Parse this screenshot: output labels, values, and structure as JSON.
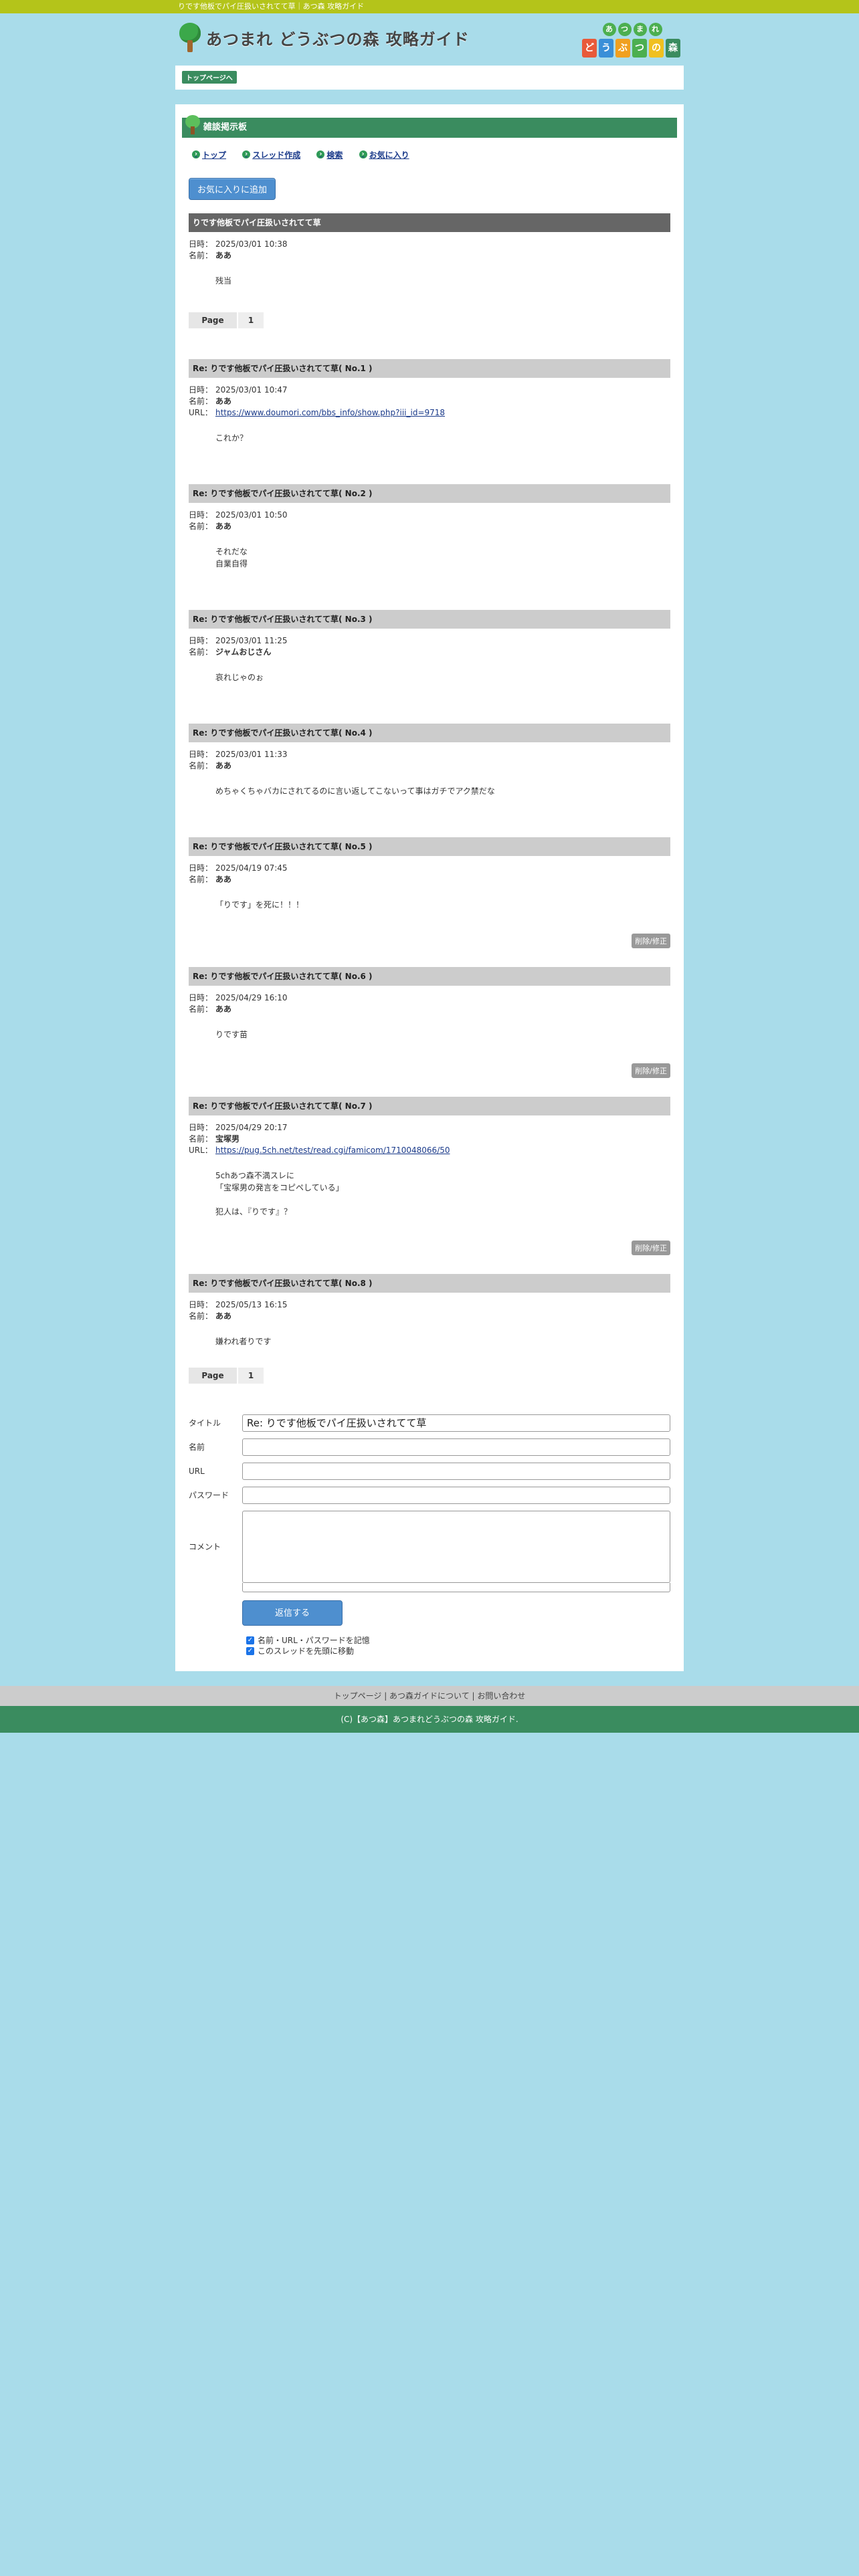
{
  "topbar": {
    "title": "りです他板でパイ圧扱いされてて草｜あつ森 攻略ガイド"
  },
  "header": {
    "logo_text": "あつまれ どうぶつの森 攻略ガイド",
    "brand_top": [
      "あ",
      "つ",
      "ま",
      "れ"
    ],
    "brand_bottom": [
      "ど",
      "う",
      "ぶ",
      "つ",
      "の",
      "森"
    ]
  },
  "breadcrumb": {
    "top": "トップページへ"
  },
  "section": {
    "title": "雑談掲示板"
  },
  "nav": {
    "top": "トップ",
    "new_thread": "スレッド作成",
    "search": "検索",
    "favorites": "お気に入り"
  },
  "fav_button": "お気に入りに追加",
  "labels": {
    "date": "日時：",
    "name": "名前：",
    "url": "URL：",
    "page": "Page",
    "page_num": "1",
    "delete": "削除/修正"
  },
  "thread": {
    "title": "りです他板でパイ圧扱いされてて草",
    "date": "2025/03/01 10:38",
    "name": "ああ",
    "body": [
      "残当"
    ]
  },
  "posts": [
    {
      "title": "Re: りです他板でパイ圧扱いされてて草( No.1 )",
      "date": "2025/03/01 10:47",
      "name": "ああ",
      "url": "https://www.doumori.com/bbs_info/show.php?iii_id=9718",
      "body": [
        "これか？"
      ],
      "delete": false
    },
    {
      "title": "Re: りです他板でパイ圧扱いされてて草( No.2 )",
      "date": "2025/03/01 10:50",
      "name": "ああ",
      "url": "",
      "body": [
        "それだな",
        "自業自得"
      ],
      "delete": false
    },
    {
      "title": "Re: りです他板でパイ圧扱いされてて草( No.3 )",
      "date": "2025/03/01 11:25",
      "name": "ジャムおじさん",
      "url": "",
      "body": [
        "哀れじゃのぉ"
      ],
      "delete": false
    },
    {
      "title": "Re: りです他板でパイ圧扱いされてて草( No.4 )",
      "date": "2025/03/01 11:33",
      "name": "ああ",
      "url": "",
      "body": [
        "めちゃくちゃバカにされてるのに言い返してこないって事はガチでアク禁だな"
      ],
      "delete": false
    },
    {
      "title": "Re: りです他板でパイ圧扱いされてて草( No.5 )",
      "date": "2025/04/19 07:45",
      "name": "ああ",
      "url": "",
      "body": [
        "「りです」を死に！！！"
      ],
      "delete": true
    },
    {
      "title": "Re: りです他板でパイ圧扱いされてて草( No.6 )",
      "date": "2025/04/29 16:10",
      "name": "ああ",
      "url": "",
      "body": [
        "りです苗"
      ],
      "delete": true
    },
    {
      "title": "Re: りです他板でパイ圧扱いされてて草( No.7 )",
      "date": "2025/04/29 20:17",
      "name": "宝塚男",
      "url": "https://pug.5ch.net/test/read.cgi/famicom/1710048066/50",
      "body": [
        "5chあつ森不満スレに",
        "「宝塚男の発言をコピペしている」",
        "",
        "犯人は、『りです』？"
      ],
      "delete": true
    },
    {
      "title": "Re: りです他板でパイ圧扱いされてて草( No.8 )",
      "date": "2025/05/13 16:15",
      "name": "ああ",
      "url": "",
      "body": [
        "嫌われ者りです"
      ],
      "delete": false
    }
  ],
  "form": {
    "title_label": "タイトル",
    "title_value": "Re: りです他板でパイ圧扱いされてて草",
    "name_label": "名前",
    "url_label": "URL",
    "password_label": "パスワード",
    "comment_label": "コメント",
    "submit": "返信する",
    "remember": "名前・URL・パスワードを記憶",
    "move_top": "このスレッドを先頭に移動"
  },
  "footer": {
    "links": "トップページ | あつ森ガイドについて | お問い合わせ",
    "copyright": "(C)【あつ森】あつまれどうぶつの森 攻略ガイド."
  },
  "colors": {
    "accent": "#3a8c5f",
    "topbar": "#b4c41a",
    "background": "#a9dcea",
    "button": "#4e8fcf"
  }
}
